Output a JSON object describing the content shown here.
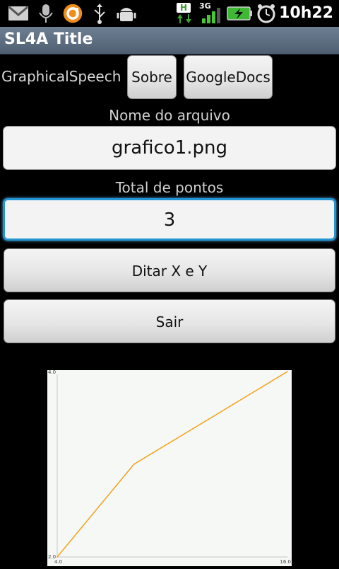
{
  "status_bar": {
    "icons": [
      "gmail-icon",
      "voice-search-icon",
      "orange-app-icon",
      "usb-icon",
      "android-debug-icon",
      "hsdpa-data-icon",
      "signal-3g-icon",
      "battery-charging-icon",
      "alarm-clock-icon"
    ],
    "network_h": "H",
    "network_3g": "3G",
    "time": "10h22"
  },
  "title_bar": {
    "title": "SL4A Title"
  },
  "app": {
    "name": "GraphicalSpeech",
    "about_button": "Sobre",
    "docs_button": "GoogleDocs",
    "filename_label": "Nome do arquivo",
    "filename_value": "grafico1.png",
    "points_label": "Total de pontos",
    "points_value": "3",
    "dictate_button": "Ditar X e Y",
    "exit_button": "Sair"
  },
  "colors": {
    "accent_focus": "#2196d3",
    "line": "#f5a21b",
    "chart_bg": "#f5f8f4"
  },
  "chart_data": {
    "type": "line",
    "x": [
      4.0,
      8.0,
      16.0
    ],
    "y": [
      2.0,
      3.0,
      4.0
    ],
    "xlim": [
      4.0,
      16.0
    ],
    "ylim": [
      2.0,
      4.0
    ],
    "x_ticks": [
      "4.0",
      "16.0"
    ],
    "y_ticks": [
      "2.0",
      "4.0"
    ],
    "title": "",
    "xlabel": "",
    "ylabel": "",
    "grid": false
  }
}
